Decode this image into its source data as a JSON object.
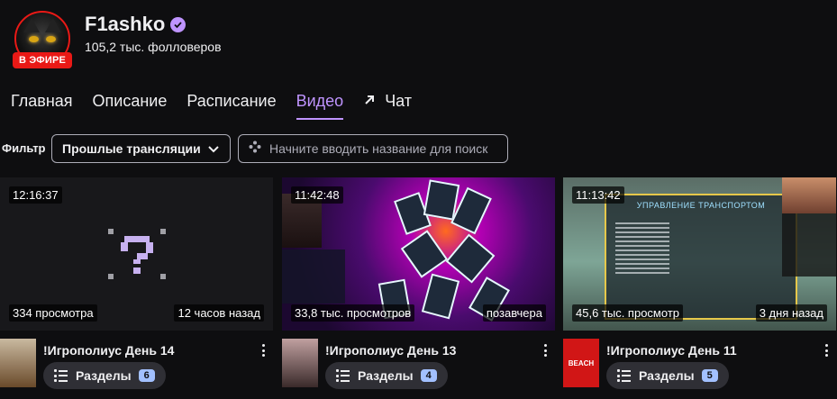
{
  "channel": {
    "name": "F1ashko",
    "followers": "105,2 тыс. фолловеров",
    "live_label": "В ЭФИРЕ",
    "verified_icon": "verified-check-icon"
  },
  "tabs": [
    {
      "label": "Главная",
      "active": false
    },
    {
      "label": "Описание",
      "active": false
    },
    {
      "label": "Расписание",
      "active": false
    },
    {
      "label": "Видео",
      "active": true
    },
    {
      "label": "Чат",
      "active": false,
      "icon": "external-arrow-icon"
    }
  ],
  "filter": {
    "label": "Фильтр",
    "selected": "Прошлые трансляции",
    "search_placeholder": "Начните вводить название для поиск"
  },
  "videos": [
    {
      "duration": "12:16:37",
      "views": "334 просмотра",
      "date": "12 часов назад",
      "title": "!Игрополиус День 14",
      "chapters_label": "Разделы",
      "chapters_count": "6"
    },
    {
      "duration": "11:42:48",
      "views": "33,8 тыс. просмотров",
      "date": "позавчера",
      "title": "!Игрополиус День 13",
      "chapters_label": "Разделы",
      "chapters_count": "4"
    },
    {
      "duration": "11:13:42",
      "views": "45,6 тыс. просмотр",
      "date": "3 дня назад",
      "title": "!Игрополиус День 11",
      "chapters_label": "Разделы",
      "chapters_count": "5",
      "game_menu_title": "УПРАВЛЕНИЕ ТРАНСПОРТОМ",
      "small_thumb_text": "BEACH"
    }
  ],
  "colors": {
    "accent": "#bf94ff",
    "live": "#e91916",
    "background": "#0e0e10",
    "chip": "#2f2f35"
  }
}
